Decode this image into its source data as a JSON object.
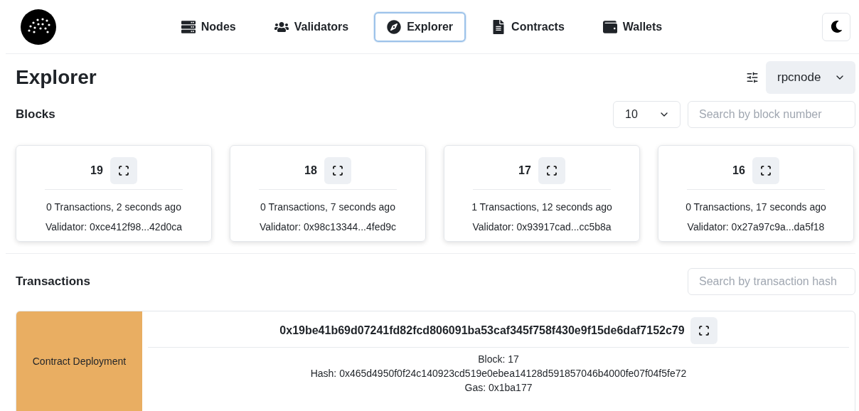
{
  "nav": [
    {
      "label": "Nodes",
      "selected": false
    },
    {
      "label": "Validators",
      "selected": false
    },
    {
      "label": "Explorer",
      "selected": true
    },
    {
      "label": "Contracts",
      "selected": false
    },
    {
      "label": "Wallets",
      "selected": false
    }
  ],
  "page_title": "Explorer",
  "node_select": {
    "value": "rpcnode"
  },
  "blocks": {
    "title": "Blocks",
    "count_select": {
      "value": "10"
    },
    "search": {
      "placeholder": "Search by block number"
    },
    "items": [
      {
        "number": "19",
        "summary": "0 Transactions, 2 seconds ago",
        "validator": "Validator: 0xce412f98...42d0ca"
      },
      {
        "number": "18",
        "summary": "0 Transactions, 7 seconds ago",
        "validator": "Validator: 0x98c13344...4fed9c"
      },
      {
        "number": "17",
        "summary": "1 Transactions, 12 seconds ago",
        "validator": "Validator: 0x93917cad...cc5b8a"
      },
      {
        "number": "16",
        "summary": "0 Transactions, 17 seconds ago",
        "validator": "Validator: 0x27a97c9a...da5f18"
      }
    ]
  },
  "transactions": {
    "title": "Transactions",
    "search": {
      "placeholder": "Search by transaction hash"
    },
    "items": [
      {
        "type": "Contract Deployment",
        "id": "0x19be41b69d07241fd82fcd806091ba53caf345f758f430e9f15de6daf7152c79",
        "details": [
          "Block: 17",
          "Hash: 0x465d4950f0f24c140923cd519e0ebea14128d591857046b4000fe07f04f5fe72",
          "Gas: 0x1ba177"
        ]
      }
    ]
  }
}
